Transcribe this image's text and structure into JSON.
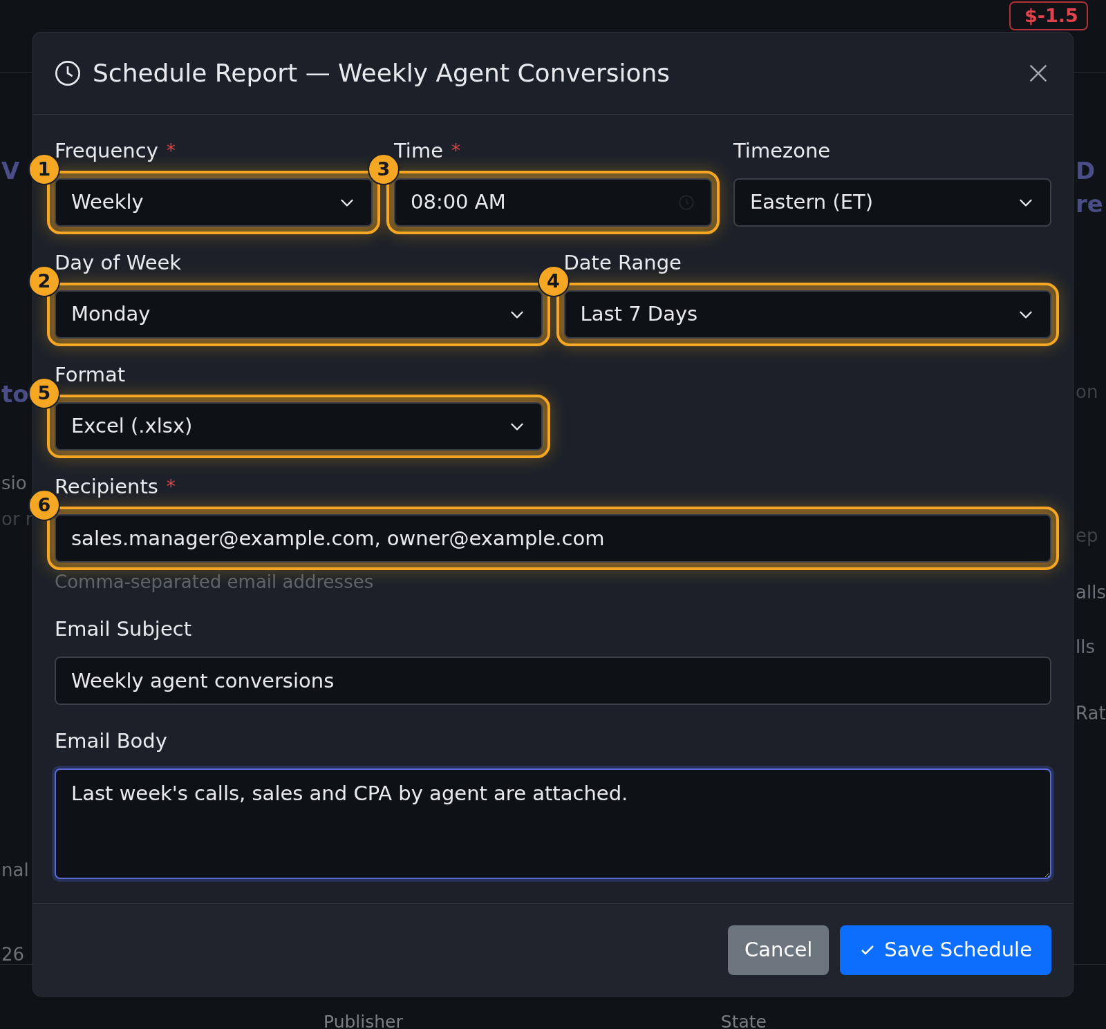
{
  "background": {
    "badge": "$-1.5",
    "left": [
      {
        "text": "V",
        "kind": "heading"
      },
      {
        "text": "to",
        "kind": "heading"
      },
      {
        "text": "sio",
        "kind": "text"
      },
      {
        "text": "or r",
        "kind": "muted"
      },
      {
        "text": "nal",
        "kind": "text"
      },
      {
        "text": "26",
        "kind": "text"
      }
    ],
    "right": [
      {
        "text": "D",
        "kind": "heading"
      },
      {
        "text": "re",
        "kind": "heading"
      },
      {
        "text": "on",
        "kind": "muted"
      },
      {
        "text": "ep",
        "kind": "muted"
      },
      {
        "text": "alls",
        "kind": "text"
      },
      {
        "text": "lls",
        "kind": "text"
      },
      {
        "text": "Rat",
        "kind": "text"
      }
    ],
    "bottom": [
      "Publisher",
      "State"
    ]
  },
  "dialog": {
    "title": "Schedule Report — Weekly Agent Conversions",
    "rows": [
      [
        {
          "label": "Frequency",
          "required_mark": "*",
          "kind": "select",
          "value": "Weekly",
          "highlighted": true,
          "badge": "1"
        },
        {
          "label": "Time",
          "required_mark": "*",
          "kind": "time",
          "value": "08:00 AM",
          "highlighted": true,
          "badge": "3"
        },
        {
          "label": "Timezone",
          "kind": "select",
          "value": "Eastern (ET)",
          "highlighted": false
        }
      ],
      [
        {
          "label": "Day of Week",
          "kind": "select",
          "value": "Monday",
          "highlighted": true,
          "badge": "2"
        },
        {
          "label": "Date Range",
          "kind": "select",
          "value": "Last 7 Days",
          "highlighted": true,
          "badge": "4"
        }
      ],
      [
        {
          "label": "Format",
          "kind": "select",
          "value": "Excel (.xlsx)",
          "highlighted": true,
          "badge": "5"
        },
        {
          "kind": "empty"
        }
      ],
      [
        {
          "label": "Recipients",
          "required_mark": "*",
          "kind": "text",
          "value": "sales.manager@example.com, owner@example.com",
          "highlighted": true,
          "badge": "6",
          "help": "Comma-separated email addresses"
        }
      ],
      [
        {
          "label": "Email Subject",
          "kind": "text",
          "value": "Weekly agent conversions",
          "highlighted": false
        }
      ],
      [
        {
          "label": "Email Body",
          "kind": "textarea",
          "value": "Last week's calls, sales and CPA by agent are attached.",
          "focused": true
        }
      ]
    ],
    "buttons": [
      {
        "label": "Cancel",
        "kind": "secondary"
      },
      {
        "label": "Save Schedule",
        "kind": "primary"
      }
    ]
  }
}
